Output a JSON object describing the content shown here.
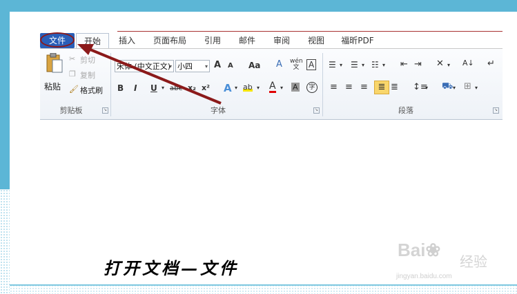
{
  "tabs": {
    "file": "文件",
    "home": "开始",
    "insert": "插入",
    "layout": "页面布局",
    "references": "引用",
    "mailings": "邮件",
    "review": "审阅",
    "view": "视图",
    "pdf": "福昕PDF"
  },
  "clipboard": {
    "paste": "粘贴",
    "cut": "剪切",
    "copy": "复制",
    "format_painter": "格式刷",
    "group_label": "剪贴板"
  },
  "font": {
    "font_name": "宋体 (中文正文)",
    "font_size": "小四",
    "group_label": "字体",
    "bold": "B",
    "italic": "I",
    "underline": "U",
    "strike": "abe",
    "subscript": "x₂",
    "superscript": "x²",
    "grow": "A",
    "shrink": "A",
    "change_case": "Aa",
    "clear_format": "A",
    "phonetic": "wén 文",
    "border_char": "A",
    "text_effect": "A",
    "highlight": "ab",
    "font_color": "A",
    "char_shade": "A",
    "enclose": "字"
  },
  "paragraph": {
    "group_label": "段落"
  },
  "caption": "打开文档—文件",
  "watermark": {
    "brand": "Bai",
    "brand2": "经验",
    "url": "jingyan.baidu.com"
  },
  "colors": {
    "file_tab": "#2a5fb8",
    "annotation": "#8b1a1a",
    "frame": "#5cb6d6"
  }
}
